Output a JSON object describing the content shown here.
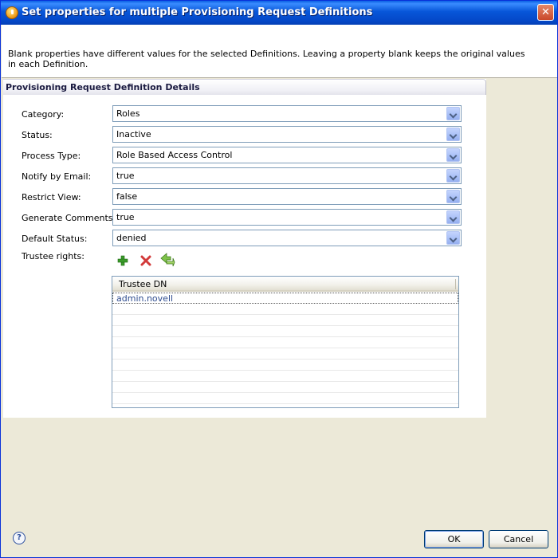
{
  "window": {
    "title": "Set properties for multiple Provisioning Request Definitions",
    "close_label": "✕"
  },
  "header": {
    "message": "Blank properties have different values for the selected Definitions.  Leaving a property blank keeps the original values in each Definition."
  },
  "panel": {
    "title": "Provisioning Request Definition Details"
  },
  "fields": {
    "category": {
      "label": "Category:",
      "value": "Roles"
    },
    "status": {
      "label": "Status:",
      "value": "Inactive"
    },
    "process_type": {
      "label": "Process Type:",
      "value": "Role Based Access Control"
    },
    "notify_email": {
      "label": "Notify by Email:",
      "value": "true"
    },
    "restrict_view": {
      "label": "Restrict View:",
      "value": "false"
    },
    "generate_comments": {
      "label": "Generate Comments:",
      "value": "true"
    },
    "default_status": {
      "label": "Default Status:",
      "value": "denied"
    }
  },
  "trustee": {
    "label": "Trustee rights:",
    "column_header": "Trustee DN",
    "rows": [
      "admin.novell"
    ],
    "icons": [
      "add-icon",
      "delete-icon",
      "edit-icon"
    ]
  },
  "buttons": {
    "ok": "OK",
    "cancel": "Cancel",
    "help": "?"
  },
  "colors": {
    "titlebar": "#0756D9",
    "dialog_bg": "#ECE9D8",
    "link_text": "#2E4C8F"
  }
}
